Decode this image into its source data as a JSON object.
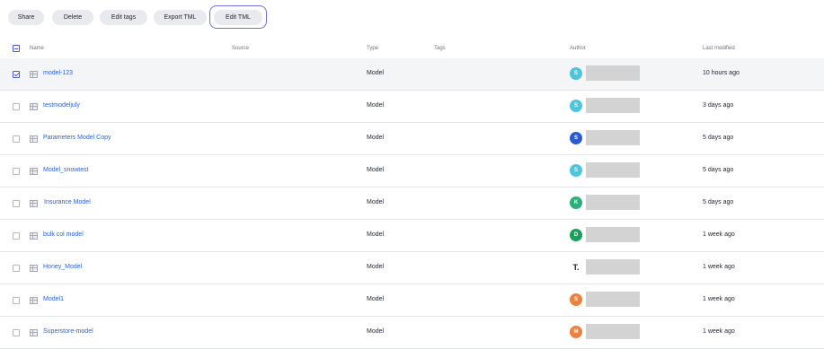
{
  "toolbar": {
    "share": "Share",
    "delete": "Delete",
    "edit_tags": "Edit tags",
    "export_tml": "Export TML",
    "edit_tml": "Edit TML"
  },
  "columns": {
    "name": "Name",
    "source": "Source",
    "type": "Type",
    "tags": "Tags",
    "author": "Author",
    "last_modified": "Last modified"
  },
  "rows": [
    {
      "name": "model-123",
      "type": "Model",
      "author_initial": "S",
      "avatar_color": "#4cc6dd",
      "modified": "10 hours ago",
      "checked": true
    },
    {
      "name": "testmodeljuly",
      "type": "Model",
      "author_initial": "S",
      "avatar_color": "#4cc6dd",
      "modified": "3 days ago",
      "checked": false
    },
    {
      "name": "Parameters Model Copy",
      "type": "Model",
      "author_initial": "S",
      "avatar_color": "#2a5bd7",
      "modified": "5 days ago",
      "checked": false
    },
    {
      "name": "Model_snowtest",
      "type": "Model",
      "author_initial": "S",
      "avatar_color": "#4cc6dd",
      "modified": "5 days ago",
      "checked": false
    },
    {
      "name": "Insurance Model",
      "type": "Model",
      "author_initial": "K",
      "avatar_color": "#28b077",
      "modified": "5 days ago",
      "checked": false
    },
    {
      "name": "bulk col model",
      "type": "Model",
      "author_initial": "D",
      "avatar_color": "#1a9e5c",
      "modified": "1 week ago",
      "checked": false
    },
    {
      "name": "Honey_Model",
      "type": "Model",
      "author_initial": "T.",
      "avatar_color": "logo",
      "modified": "1 week ago",
      "checked": false
    },
    {
      "name": "Model1",
      "type": "Model",
      "author_initial": "S",
      "avatar_color": "#f0803c",
      "modified": "1 week ago",
      "checked": false
    },
    {
      "name": "Superstore-model",
      "type": "Model",
      "author_initial": "M",
      "avatar_color": "#f0803c",
      "modified": "1 week ago",
      "checked": false
    }
  ]
}
